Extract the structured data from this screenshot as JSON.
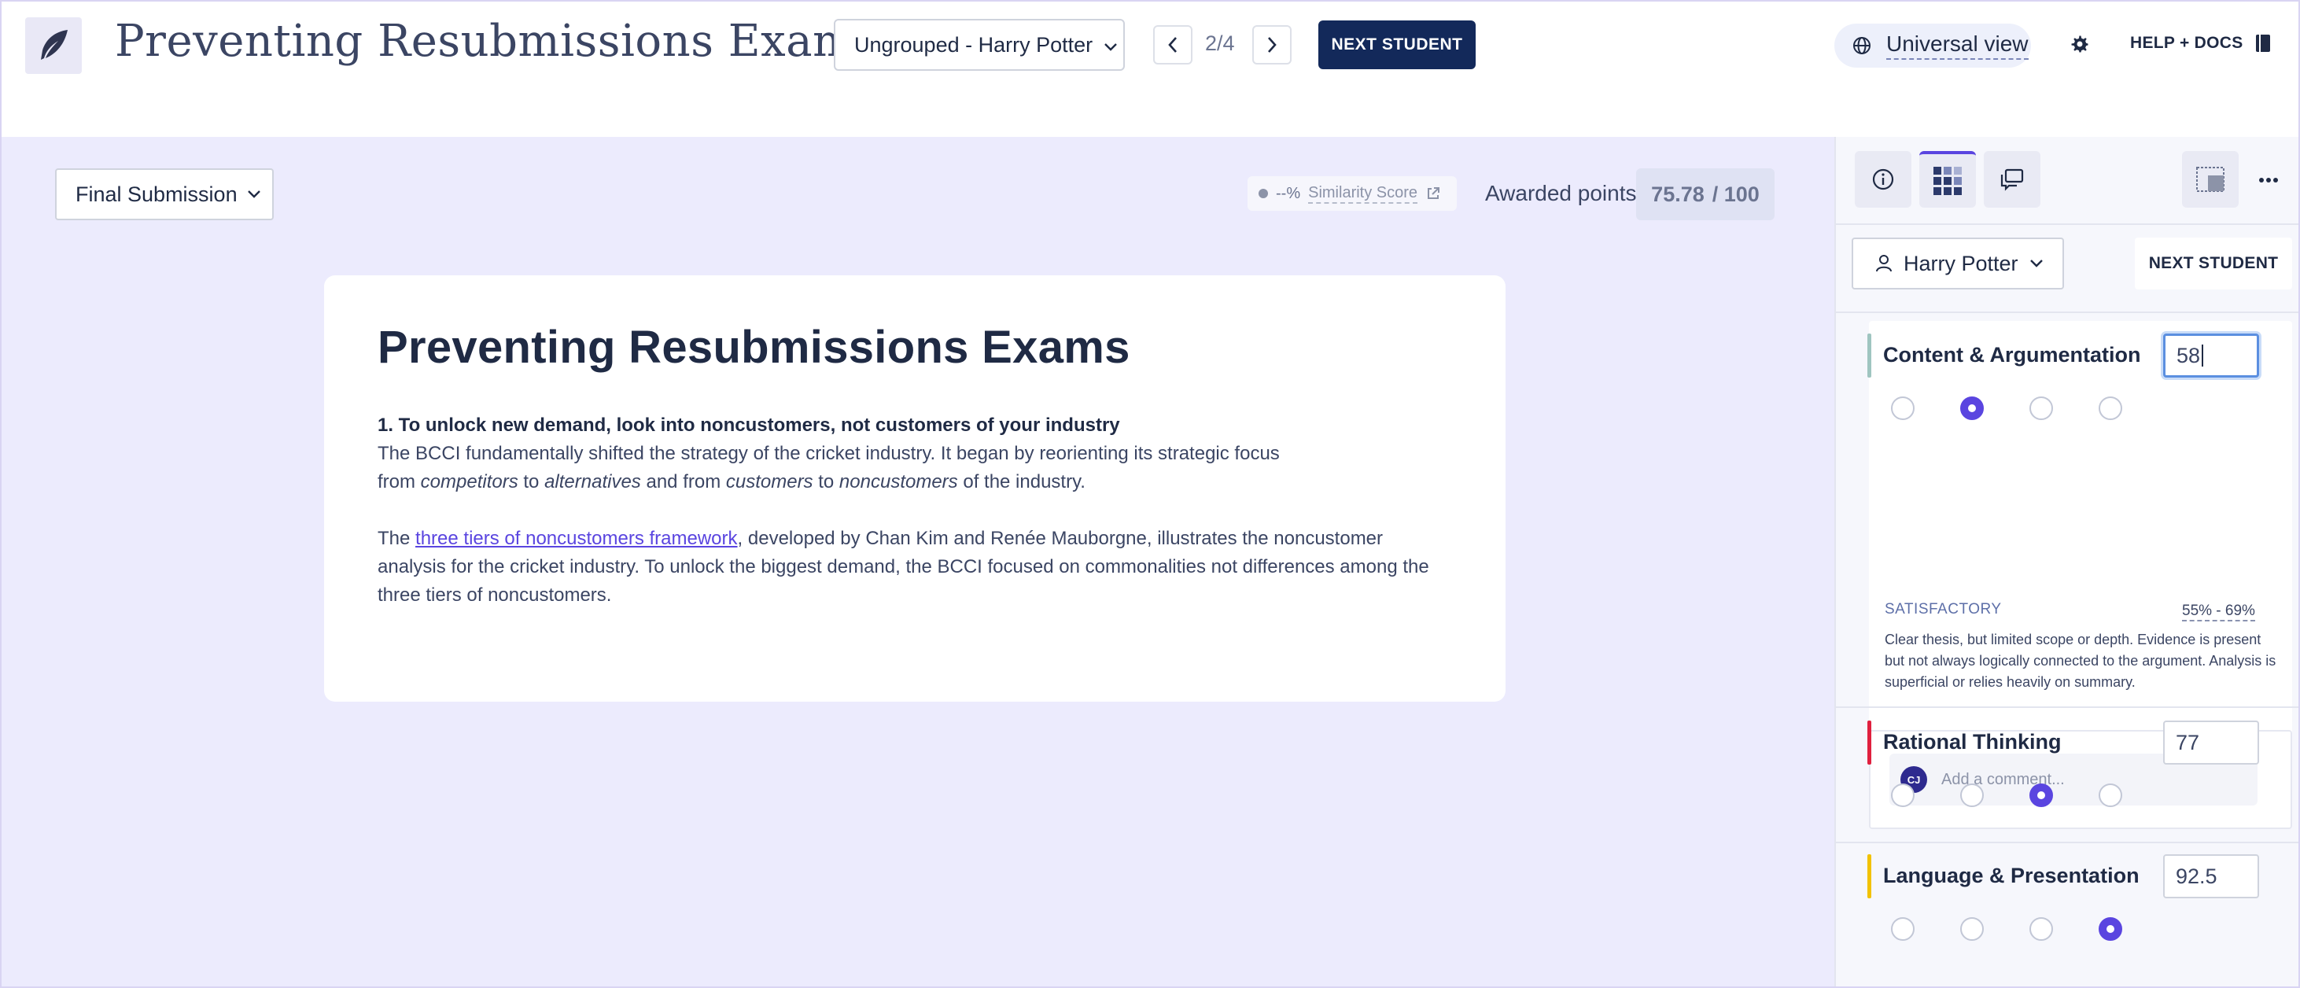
{
  "header": {
    "title": "Preventing Resubmissions Exams",
    "group_select": "Ungrouped - Harry Potter",
    "counter": "2/4",
    "next_student": "NEXT STUDENT",
    "universal_view": "Universal view",
    "help": "HELP + DOCS"
  },
  "toolbar": {
    "submission_select": "Final Submission",
    "similarity_value": "--%",
    "similarity_label": "Similarity Score",
    "awarded_label": "Awarded points",
    "awarded_value": "75.78",
    "awarded_total": "/ 100"
  },
  "document": {
    "title": "Preventing Resubmissions Exams",
    "p1_heading": "1. To unlock new demand, look into noncustomers, not customers of your industry",
    "p1_line1": "The BCCI fundamentally shifted the strategy of the cricket industry. It began by reorienting its strategic focus",
    "p1_line2_from": "from ",
    "p1_line2_competitors": "competitors",
    "p1_line2_to": " to ",
    "p1_line2_alternatives": "alternatives",
    "p1_line2_andfrom": " and from ",
    "p1_line2_customers": "customers",
    "p1_line2_to2": " to ",
    "p1_line2_noncustomers": "noncustomers",
    "p1_line2_end": " of the industry.",
    "p2_start": "The ",
    "p2_link": "three tiers of noncustomers framework",
    "p2_rest": ", developed by Chan Kim and Renée Mauborgne, illustrates the noncustomer analysis for the cricket industry. To unlock the biggest demand, the BCCI focused on commonalities not differences among the three tiers of noncustomers."
  },
  "panel": {
    "student": "Harry Potter",
    "next_student": "NEXT STUDENT",
    "criteria": [
      {
        "name": "Content & Argumentation",
        "score": "58",
        "color": "#9fc5c0",
        "selected": 2
      },
      {
        "name": "Rational Thinking",
        "score": "77",
        "color": "#e0203f",
        "selected": 3
      },
      {
        "name": "Language & Presentation",
        "score": "92.5",
        "color": "#f2c200",
        "selected": 4
      }
    ],
    "level": {
      "name": "SATISFACTORY",
      "range": "55% - 69%",
      "description": "Clear thesis, but limited scope or depth. Evidence is present but not always logically connected to the argument. Analysis is superficial or relies heavily on summary."
    },
    "comment_placeholder": "Add a comment...",
    "avatar_initials": "CJ"
  }
}
